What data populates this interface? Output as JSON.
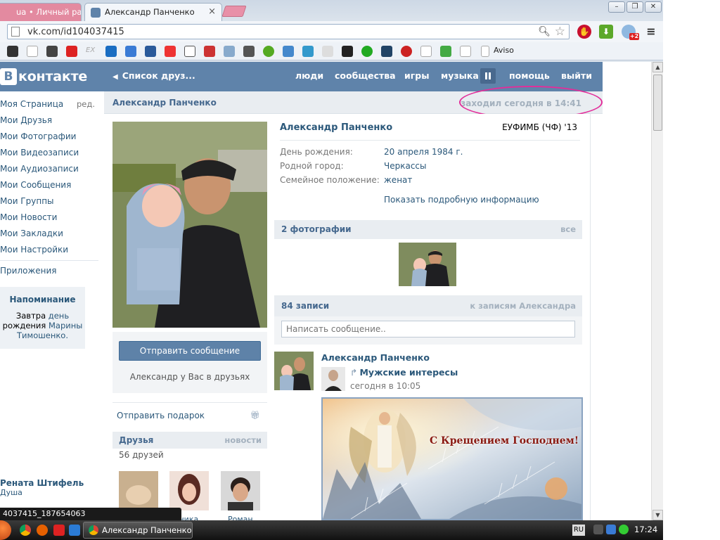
{
  "browser": {
    "tabs": [
      {
        "label": "ua • Личный разд"
      },
      {
        "label": "Александр Панченко"
      }
    ],
    "url": "vk.com/id104037415",
    "bookmark_aviso": "Aviso",
    "bookmark_ex": "EX",
    "window_controls": [
      "minimize-icon",
      "restore-icon",
      "close-icon"
    ]
  },
  "vk_header": {
    "logo": "контакте",
    "logo_letter": "В",
    "back_link": "Список друз...",
    "nav": [
      "люди",
      "сообщества",
      "игры",
      "музыка",
      "помощь",
      "выйти"
    ]
  },
  "left_menu": {
    "items": [
      "Моя Страница",
      "Мои Друзья",
      "Мои Фотографии",
      "Мои Видеозаписи",
      "Мои Аудиозаписи",
      "Мои Сообщения",
      "Мои Группы",
      "Мои Новости",
      "Мои Закладки",
      "Мои Настройки"
    ],
    "edit_label": "ред.",
    "apps": "Приложения",
    "reminder": {
      "title": "Напоминание",
      "line1_a": "Завтра",
      "line1_b": "день",
      "line2_a": "рождения",
      "line2_b": "Марины",
      "line3": "Тимошенко."
    },
    "friend_card": {
      "name": "Рената Штифель",
      "sub": "Душа"
    }
  },
  "profile": {
    "bar_name": "Александр Панченко",
    "last_seen": "заходил сегодня в 14:41",
    "send_message": "Отправить сообщение",
    "friend_status": "Александр у Вас в друзьях",
    "send_gift": "Отправить подарок",
    "friends_title": "Друзья",
    "friends_news": "новости",
    "friends_count": "56 друзей",
    "friend_names": [
      "",
      "...ника",
      "Роман"
    ],
    "name": "Александр Панченко",
    "university": "ЕУФИМБ (ЧФ) '13",
    "info": [
      {
        "label": "День рождения:",
        "value": "20 апреля 1984 г."
      },
      {
        "label": "Родной город:",
        "value": "Черкассы"
      },
      {
        "label": "Семейное положение:",
        "value": "женат"
      }
    ],
    "show_more": "Показать подробную информацию",
    "photos_title": "2 фотографии",
    "photos_all": "все",
    "wall_title": "84 записи",
    "wall_link": "к записям Александра",
    "wall_placeholder": "Написать сообщение..",
    "post": {
      "author": "Александр Панченко",
      "repost_source": "Мужские интересы",
      "time": "сегодня в 10:05",
      "image_caption": "С Крещением Господнем!"
    }
  },
  "status_url": "4037415_187654063",
  "taskbar": {
    "window_title": "Александр Панченко...",
    "lang": "RU",
    "clock": "17:24"
  },
  "colors": {
    "vk_header": "#5f83aa",
    "link": "#2b587a",
    "highlight": "#e22e9a"
  }
}
